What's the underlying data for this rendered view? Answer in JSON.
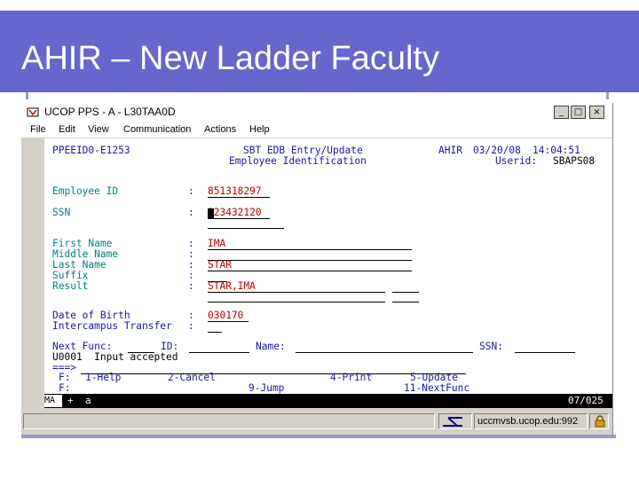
{
  "slide": {
    "title": "AHIR – New Ladder Faculty"
  },
  "window": {
    "title": "UCOP PPS - A - L30TAA0D",
    "buttons": {
      "minimize": "_",
      "maximize": "□",
      "close": "×"
    }
  },
  "menubar": [
    "File",
    "Edit",
    "View",
    "Communication",
    "Actions",
    "Help"
  ],
  "screen": {
    "header": {
      "screen_id": "PPEEID0-E1253",
      "title1": "SBT EDB Entry/Update",
      "title2": "Employee Identification",
      "system": "AHIR",
      "date": "03/20/08",
      "time": "14:04:51",
      "userid_label": "Userid:",
      "userid": "SBAPS08"
    },
    "fields": {
      "employee_id": {
        "label": "Employee ID",
        "value": "851318297"
      },
      "ssn": {
        "label": "SSN",
        "value": "123432120"
      },
      "first_name": {
        "label": "First Name",
        "value": "IMA"
      },
      "middle_name": {
        "label": "Middle Name",
        "value": ""
      },
      "last_name": {
        "label": "Last Name",
        "value": "STAR"
      },
      "suffix": {
        "label": "Suffix",
        "value": ""
      },
      "result": {
        "label": "Result",
        "value": "STAR,IMA"
      },
      "date_of_birth": {
        "label": "Date of Birth",
        "value": "030170"
      },
      "intercampus_transfer": {
        "label": "Intercampus Transfer",
        "value": ""
      }
    },
    "colon": ":",
    "nav": {
      "next_func_label": "Next Func:",
      "id_label": "ID:",
      "name_label": "Name:",
      "ssn_label": "SSN:"
    },
    "message": "U0001  Input accepted",
    "command_prompt": "===>",
    "fkeys_row1": {
      "label": "F:",
      "k1": "1-Help",
      "k2": "2-Cancel",
      "k4": "4-Print",
      "k5": "5-Update"
    },
    "fkeys_row2": {
      "label": "F:",
      "k9": "9-Jump",
      "k11": "11-NextFunc"
    }
  },
  "oia": {
    "mode": "MA",
    "indicator": "+",
    "session": "a",
    "cursor_pos": "07/025"
  },
  "statusbar": {
    "host": "uccmvsb.ucop.edu:992"
  },
  "colors": {
    "header_bg": "#6666cc",
    "field_blue": "#1818a0",
    "label_teal": "#008080",
    "input_red": "#c00000"
  }
}
